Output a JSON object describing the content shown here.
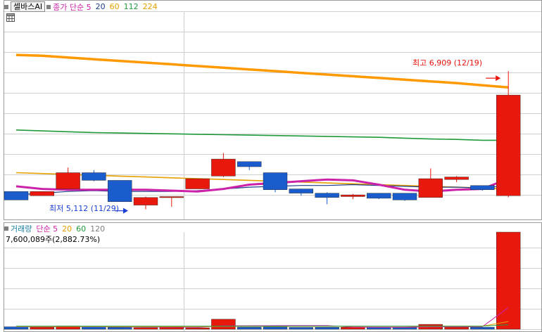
{
  "price_legend": {
    "stock_tab": "셀바스AI",
    "ma_label": "종가 단순 5",
    "ma_periods": [
      "20",
      "60",
      "112",
      "224"
    ],
    "colors": {
      "ma_label": "#cc22aa",
      "20": "#1a3c8c",
      "60": "#e6a000",
      "112": "#1f9a3a",
      "224": "#e6a000"
    }
  },
  "volume_legend": {
    "label": "거래량",
    "ma_label": "단순 5",
    "ma_periods": [
      "20",
      "60",
      "120"
    ],
    "info": "7,600,089주(2,882.73%)",
    "colors": {
      "label": "#1a7fa0",
      "ma_label": "#cc22aa",
      "20": "#e6a000",
      "60": "#1f9a3a",
      "120": "#7f7f7f"
    }
  },
  "annotations": {
    "high": {
      "text": "최고 6,909 (12/19)",
      "color": "#e8140a"
    },
    "low": {
      "text": "최저 5,112 (11/29)",
      "color": "#1a3fd6"
    }
  },
  "colors": {
    "up": "#e8180c",
    "down": "#1a5ccc",
    "grid": "#cfcfcf"
  },
  "chart_data": [
    {
      "type": "candlestick",
      "title": "셀바스AI",
      "ylim": [
        5000,
        7000
      ],
      "dates_shown": [
        "11/29",
        "12/19"
      ],
      "series": [
        {
          "name": "price",
          "ohlc": [
            [
              5300,
              5300,
              5200,
              5200
            ],
            [
              5250,
              5300,
              5250,
              5300
            ],
            [
              5330,
              5580,
              5330,
              5520
            ],
            [
              5520,
              5550,
              5420,
              5430
            ],
            [
              5430,
              5430,
              5180,
              5180
            ],
            [
              5140,
              5240,
              5090,
              5230
            ],
            [
              5230,
              5230,
              5120,
              5240
            ],
            [
              5330,
              5330,
              5330,
              5450
            ],
            [
              5480,
              5750,
              5470,
              5680
            ],
            [
              5650,
              5650,
              5550,
              5590
            ],
            [
              5520,
              5520,
              5290,
              5320
            ],
            [
              5330,
              5330,
              5250,
              5280
            ],
            [
              5280,
              5290,
              5150,
              5230
            ],
            [
              5240,
              5270,
              5210,
              5260
            ],
            [
              5280,
              5280,
              5210,
              5220
            ],
            [
              5280,
              5280,
              5190,
              5200
            ],
            [
              5230,
              5570,
              5230,
              5450
            ],
            [
              5440,
              5480,
              5410,
              5470
            ],
            [
              5370,
              5370,
              5310,
              5320
            ],
            [
              5250,
              6710,
              5230,
              6430
            ]
          ]
        },
        {
          "name": "종가 단순 5",
          "color": "#cc22aa",
          "values": [
            5360,
            5330,
            5320,
            5320,
            5320,
            5320,
            5310,
            5300,
            5330,
            5380,
            5400,
            5420,
            5440,
            5430,
            5380,
            5320,
            5300,
            5320,
            5330,
            5450
          ]
        },
        {
          "name": "20",
          "color": "#1a3c8c",
          "values": [
            5260,
            5280,
            5300,
            5310,
            5300,
            5300,
            5300,
            5310,
            5330,
            5350,
            5360,
            5370,
            5370,
            5380,
            5370,
            5360,
            5350,
            5350,
            5340,
            5370
          ]
        },
        {
          "name": "60",
          "color": "#e6a000",
          "values": [
            5520,
            5510,
            5500,
            5490,
            5480,
            5470,
            5460,
            5450,
            5440,
            5430,
            5420,
            5410,
            5400,
            5390,
            5380,
            5370,
            5360,
            5350,
            5340,
            5330
          ]
        },
        {
          "name": "112",
          "color": "#1f9a3a",
          "values": [
            6020,
            6010,
            6000,
            5990,
            5985,
            5980,
            5975,
            5970,
            5965,
            5960,
            5955,
            5950,
            5945,
            5940,
            5935,
            5925,
            5915,
            5910,
            5900,
            5900
          ]
        },
        {
          "name": "224",
          "color": "#ff9900",
          "values": [
            6900,
            6890,
            6870,
            6850,
            6830,
            6810,
            6790,
            6770,
            6750,
            6730,
            6710,
            6690,
            6670,
            6650,
            6630,
            6610,
            6590,
            6570,
            6545,
            6520
          ]
        }
      ]
    },
    {
      "type": "bar",
      "title": "거래량",
      "ylim": [
        0,
        7600089
      ],
      "series": [
        {
          "name": "거래량",
          "values": [
            190000,
            160000,
            250000,
            180000,
            150000,
            120000,
            140000,
            110000,
            780000,
            160000,
            170000,
            140000,
            150000,
            150000,
            150000,
            130000,
            380000,
            160000,
            150000,
            7600089
          ]
        },
        {
          "name": "단순 5",
          "color": "#cc22aa",
          "values": [
            200000,
            190000,
            200000,
            200000,
            190000,
            170000,
            170000,
            150000,
            260000,
            270000,
            280000,
            280000,
            280000,
            160000,
            150000,
            150000,
            190000,
            190000,
            200000,
            1690000
          ]
        },
        {
          "name": "20",
          "color": "#e6a000",
          "values": [
            210000,
            210000,
            210000,
            210000,
            200000,
            200000,
            200000,
            200000,
            220000,
            220000,
            220000,
            220000,
            220000,
            220000,
            220000,
            220000,
            230000,
            230000,
            230000,
            600000
          ]
        },
        {
          "name": "60",
          "color": "#1f9a3a",
          "values": [
            230000,
            230000,
            230000,
            230000,
            230000,
            230000,
            230000,
            230000,
            230000,
            230000,
            230000,
            230000,
            230000,
            230000,
            230000,
            230000,
            230000,
            230000,
            230000,
            350000
          ]
        }
      ]
    }
  ]
}
